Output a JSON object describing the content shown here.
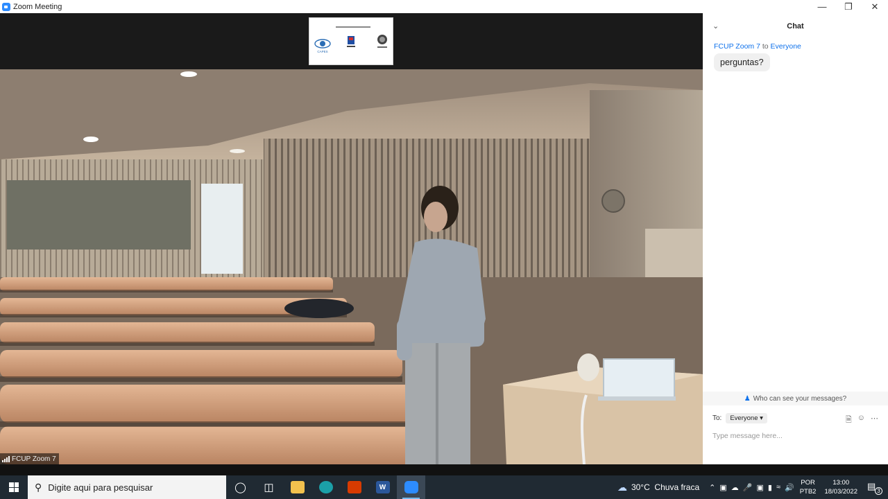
{
  "window": {
    "title": "Zoom Meeting",
    "minimize_glyph": "—",
    "restore_glyph": "❐",
    "close_glyph": "✕"
  },
  "video": {
    "participant_name": "FCUP Zoom 7",
    "shared_screen_email": "bbpesquisas@gmail.com",
    "shared_screen_logo_label": "CAPES"
  },
  "chat": {
    "title": "Chat",
    "messages": [
      {
        "from": "FCUP Zoom 7",
        "to_word": "to",
        "recipient": "Everyone",
        "text": "perguntas?"
      }
    ],
    "who_can_see": "Who can see your messages?",
    "to_label": "To:",
    "to_value": "Everyone",
    "input_placeholder": "Type message here..."
  },
  "taskbar": {
    "search_placeholder": "Digite aqui para pesquisar",
    "weather": "30°C  Chuva fraca",
    "lang_line1": "POR",
    "lang_line2": "PTB2",
    "time": "13:00",
    "date": "18/03/2022",
    "notification_count": "3",
    "apps": [
      "cortana",
      "task-view",
      "file-explorer",
      "edge",
      "office",
      "word",
      "zoom"
    ]
  },
  "colors": {
    "zoom_blue": "#2D8CFF",
    "chat_link_blue": "#0E71EB",
    "taskbar_bg": "#202a33"
  }
}
